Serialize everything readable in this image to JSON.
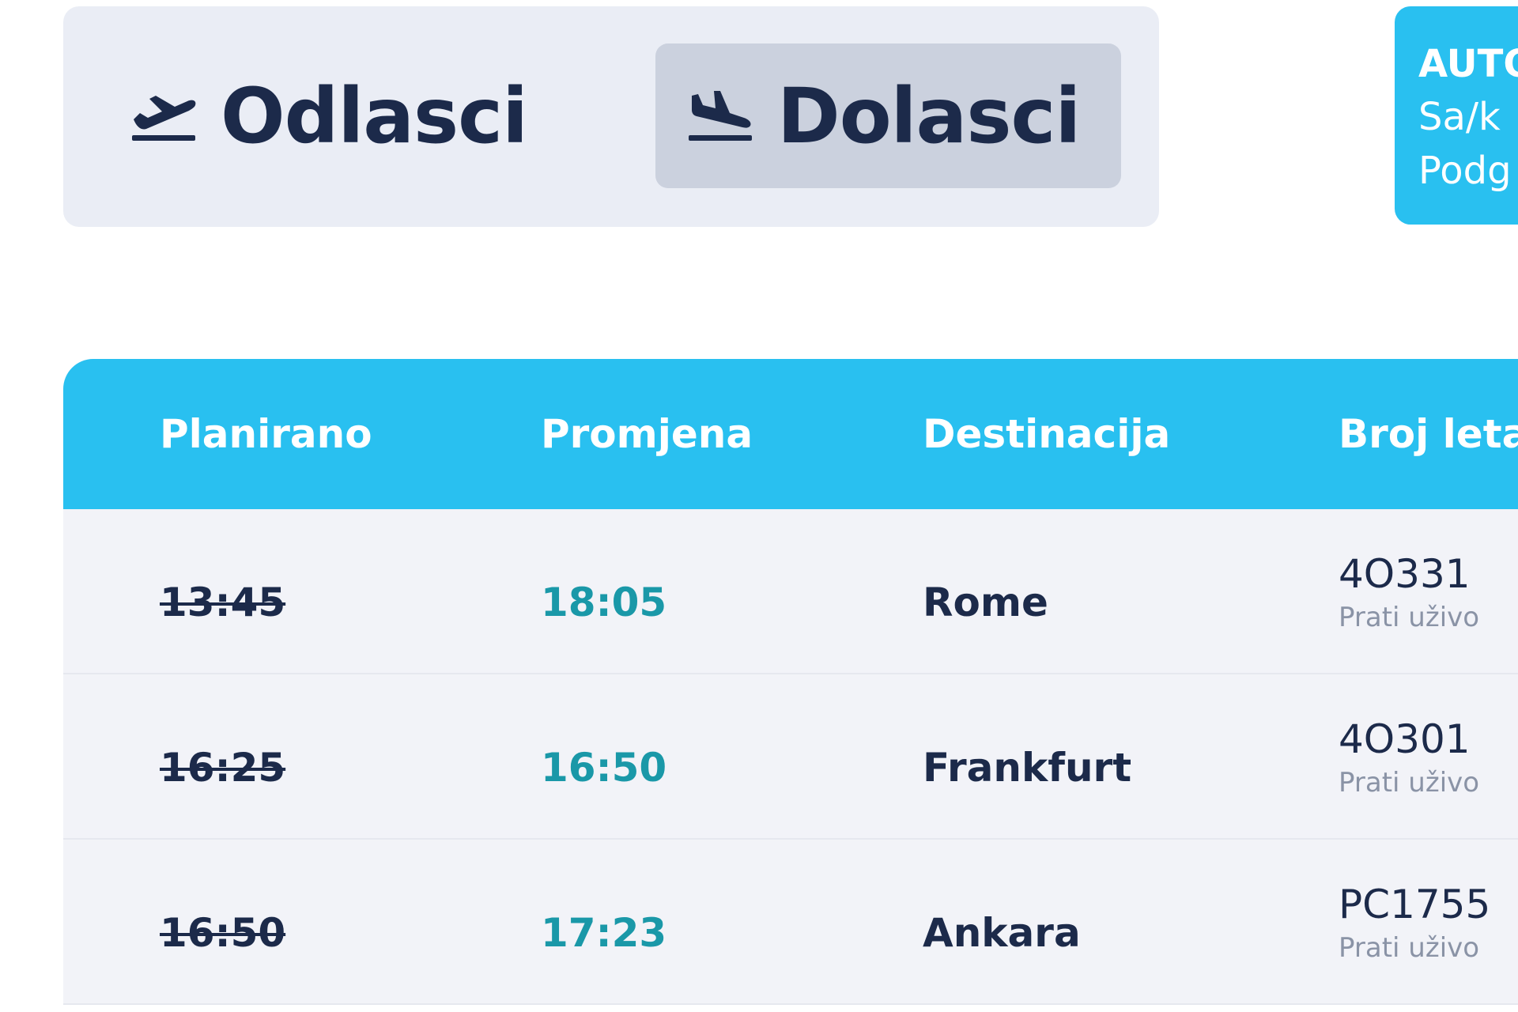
{
  "tabs": {
    "departures_label": "Odlasci",
    "arrivals_label": "Dolasci",
    "active": "arrivals"
  },
  "info_card": {
    "title": "AUTO",
    "line1": "Sa/k",
    "line2": "Podg"
  },
  "table": {
    "headers": [
      "Planirano",
      "Promjena",
      "Destinacija",
      "Broj leta"
    ],
    "rows": [
      {
        "planned": "13:45",
        "changed": "18:05",
        "destination": "Rome",
        "flight": "4O331",
        "live_label": "Prati uživo"
      },
      {
        "planned": "16:25",
        "changed": "16:50",
        "destination": "Frankfurt",
        "flight": "4O301",
        "live_label": "Prati uživo"
      },
      {
        "planned": "16:50",
        "changed": "17:23",
        "destination": "Ankara",
        "flight": "PC1755",
        "live_label": "Prati uživo"
      }
    ]
  },
  "colors": {
    "accent": "#29c0f0",
    "changed_time": "#1a98a8",
    "text_dark": "#1c2a4a",
    "tab_bg": "#eaedf5",
    "tab_active_bg": "#cbd1de",
    "row_bg": "#f2f3f8"
  },
  "icons": {
    "departures": "plane-takeoff-icon",
    "arrivals": "plane-landing-icon"
  }
}
